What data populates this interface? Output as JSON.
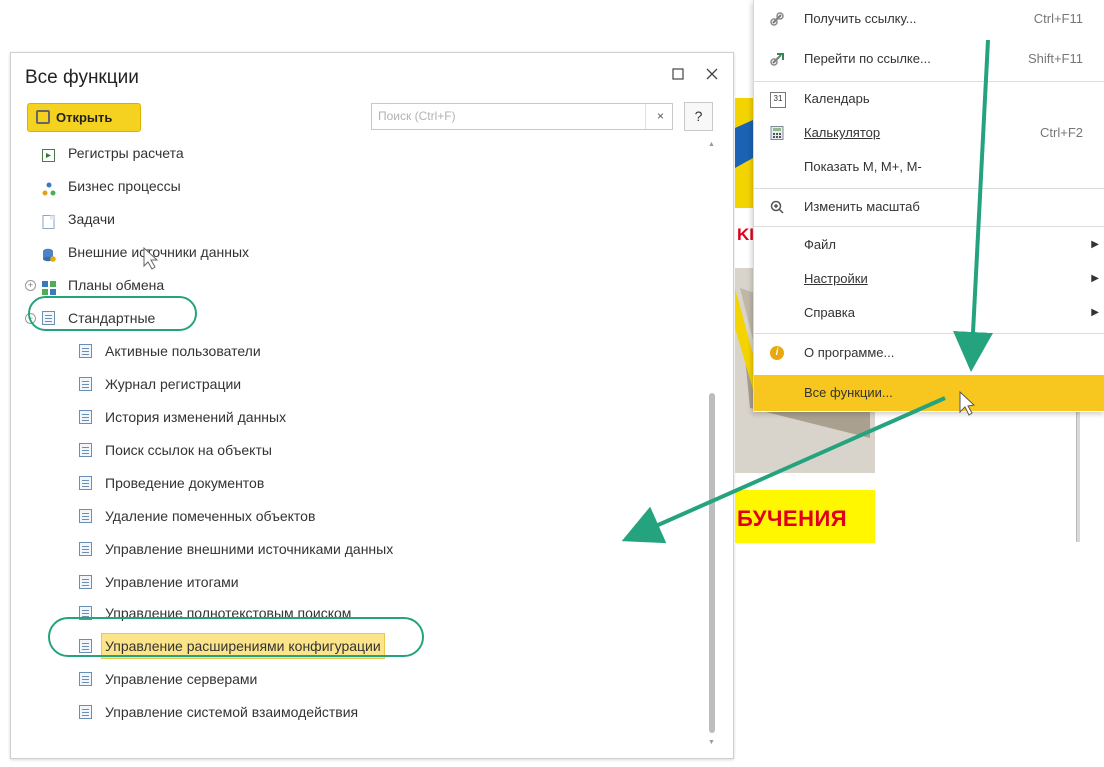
{
  "window": {
    "title": "Все функции",
    "maximize_icon": "maximize-icon",
    "close_icon": "close-icon",
    "open_button_label": "Открыть",
    "search_placeholder": "Поиск (Ctrl+F)",
    "search_clear": "×",
    "help_label": "?"
  },
  "tree": [
    {
      "label": "Регистры расчета",
      "icon": "register-icon"
    },
    {
      "label": "Бизнес процессы",
      "icon": "business-process-icon"
    },
    {
      "label": "Задачи",
      "icon": "task-icon"
    },
    {
      "label": "Внешние источники данных",
      "icon": "external-source-icon"
    },
    {
      "label": "Планы обмена",
      "icon": "exchange-plan-icon"
    },
    {
      "label": "Стандартные",
      "icon": "standard-icon"
    },
    {
      "label": "Активные пользователи"
    },
    {
      "label": "Журнал регистрации"
    },
    {
      "label": "История изменений данных"
    },
    {
      "label": "Поиск ссылок на объекты"
    },
    {
      "label": "Проведение документов"
    },
    {
      "label": "Удаление помеченных объектов"
    },
    {
      "label": "Управление внешними источниками данных"
    },
    {
      "label": "Управление итогами"
    },
    {
      "label": "Управление полнотекстовым поиском"
    },
    {
      "label": "Управление расширениями конфигурации"
    },
    {
      "label": "Управление серверами"
    },
    {
      "label": "Управление системой взаимодействия"
    }
  ],
  "menu": {
    "items": [
      {
        "label": "Получить ссылку...",
        "shortcut": "Ctrl+F11",
        "icon": "link-icon"
      },
      {
        "label": "Перейти по ссылке...",
        "shortcut": "Shift+F11",
        "icon": "goto-link-icon"
      },
      {
        "label": "Календарь",
        "shortcut": "",
        "icon": "calendar-icon"
      },
      {
        "label": "Калькулятор",
        "shortcut": "Ctrl+F2",
        "icon": "calculator-icon"
      },
      {
        "label": "Показать М, М+, М-",
        "shortcut": "",
        "icon": ""
      },
      {
        "label": "Изменить масштаб",
        "shortcut": "",
        "icon": "zoom-icon"
      },
      {
        "label": "Файл",
        "shortcut": "",
        "icon": ""
      },
      {
        "label": "Настройки",
        "shortcut": "",
        "icon": ""
      },
      {
        "label": "Справка",
        "shortcut": "",
        "icon": ""
      },
      {
        "label": "О программе...",
        "shortcut": "",
        "icon": "info-icon"
      },
      {
        "label": "Все функции...",
        "shortcut": "",
        "icon": ""
      }
    ],
    "calendar_glyph": "31",
    "info_glyph": "i",
    "submenu_arrow": "▶"
  },
  "banner": {
    "text_top": "KI",
    "text_bottom": "БУЧЕНИЯ"
  },
  "colors": {
    "accent_yellow": "#f7c71f",
    "annotation_green": "#25a37e",
    "banner_red": "#e0001a"
  }
}
